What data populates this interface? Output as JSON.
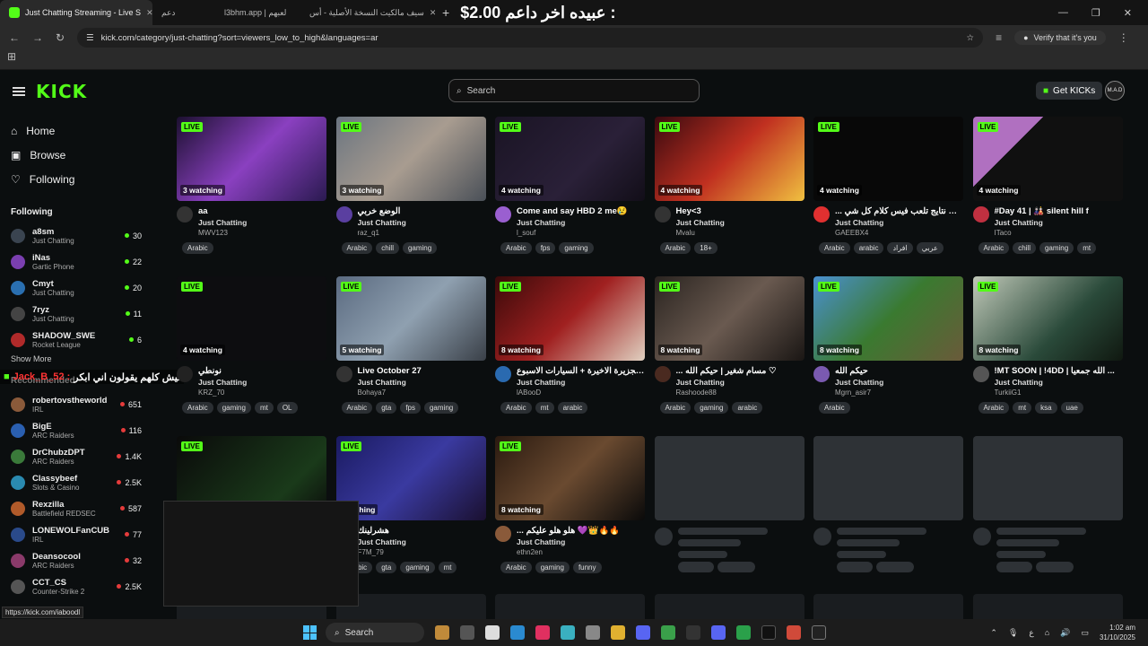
{
  "browser": {
    "tabs": [
      {
        "label": "Just Chatting Streaming - Live S",
        "active": true
      },
      {
        "label": "دعم",
        "active": false
      },
      {
        "label": "l3bhm.app | لعبهم",
        "active": false
      },
      {
        "label": "سيف مالكيت النسخة الأصلية - أس",
        "active": false
      }
    ],
    "new_tab": "+",
    "url": "kick.com/category/just-chatting?sort=viewers_low_to_high&languages=ar",
    "verify_label": "Verify that it's you",
    "status_url": "https://kick.com/iaboodl"
  },
  "donation": {
    "text": "عبيده اخر داعم :",
    "amount": "$2.00"
  },
  "header": {
    "logo": "KICK",
    "search_placeholder": "Search",
    "get_kicks": "Get KICKs",
    "avatar": "M.A.D"
  },
  "sidebar": {
    "nav": [
      {
        "label": "Home",
        "icon": "home-icon"
      },
      {
        "label": "Browse",
        "icon": "browse-icon"
      },
      {
        "label": "Following",
        "icon": "heart-icon"
      }
    ],
    "following_title": "Following",
    "following": [
      {
        "name": "a8sm",
        "game": "Just Chatting",
        "viewers": "30",
        "color": "#3a4450"
      },
      {
        "name": "iNas",
        "game": "Gartic Phone",
        "viewers": "22",
        "color": "#7a3fb0"
      },
      {
        "name": "Cmyt",
        "game": "Just Chatting",
        "viewers": "20",
        "color": "#2a6fb0"
      },
      {
        "name": "7ryz",
        "game": "Just Chatting",
        "viewers": "11",
        "color": "#444"
      },
      {
        "name": "SHADOW_SWE",
        "game": "Rocket League",
        "viewers": "6",
        "color": "#b02a2a"
      }
    ],
    "show_more": "Show More",
    "recommended_title": "Recommended",
    "recommended": [
      {
        "name": "robertovstheworld",
        "game": "IRL",
        "viewers": "651",
        "color": "#8a5a3a"
      },
      {
        "name": "BigE",
        "game": "ARC Raiders",
        "viewers": "116",
        "color": "#2a5fb0"
      },
      {
        "name": "DrChubzDPT",
        "game": "ARC Raiders",
        "viewers": "1.4K",
        "color": "#3a7a3a"
      },
      {
        "name": "Classybeef",
        "game": "Slots & Casino",
        "viewers": "2.5K",
        "color": "#2a8ab0"
      },
      {
        "name": "Rexzilla",
        "game": "Battlefield REDSEC",
        "viewers": "587",
        "color": "#b05a2a"
      },
      {
        "name": "LONEWOLFanCUB",
        "game": "IRL",
        "viewers": "77",
        "color": "#2a4a8a"
      },
      {
        "name": "Deansocool",
        "game": "ARC Raiders",
        "viewers": "32",
        "color": "#8a3a6a"
      },
      {
        "name": "CCT_CS",
        "game": "Counter-Strike 2",
        "viewers": "2.5K",
        "color": "#555"
      }
    ]
  },
  "chat_overlay": {
    "user": "Jack_B_52 :",
    "message": "ليش كلهم يقولون اني ابكر"
  },
  "streams": [
    {
      "title": "aa",
      "category": "Just Chatting",
      "user": "MWV123",
      "watching": "3 watching",
      "tags": [
        "Arabic"
      ],
      "bg": "linear-gradient(135deg,#1c1030,#8a40c0 50%,#2a1a50)",
      "av": "#333"
    },
    {
      "title": "الوضع خربي",
      "category": "Just Chatting",
      "user": "raz_q1",
      "watching": "3 watching",
      "tags": [
        "Arabic",
        "chill",
        "gaming"
      ],
      "bg": "linear-gradient(135deg,#6b7580,#a89c90 50%,#4a5058)",
      "av": "#5a3fa0"
    },
    {
      "title": "Come and say HBD 2 me😢",
      "category": "Just Chatting",
      "user": "l_souf",
      "watching": "4 watching",
      "tags": [
        "Arabic",
        "fps",
        "gaming"
      ],
      "bg": "linear-gradient(135deg,#1a1424,#2a2038 60%,#120e18)",
      "av": "#9a5fd0"
    },
    {
      "title": "Hey<3",
      "category": "Just Chatting",
      "user": "Mvalu",
      "watching": "4 watching",
      "tags": [
        "Arabic",
        "18+"
      ],
      "bg": "linear-gradient(135deg,#3a0a10,#c03020 50%,#f0c040)",
      "av": "#333"
    },
    {
      "title": "... هشروالي نتايج تلعب فيس كلام كل شي",
      "category": "Just Chatting",
      "user": "GAEEBX4",
      "watching": "4 watching",
      "tags": [
        "Arabic",
        "arabic",
        "افراد",
        "عربي"
      ],
      "bg": "#080808",
      "av": "#e03030"
    },
    {
      "title": "#Day 41 | 🎎 silent hill f",
      "category": "Just Chatting",
      "user": "ITaco",
      "watching": "4 watching",
      "tags": [
        "Arabic",
        "chill",
        "gaming",
        "mt"
      ],
      "bg": "linear-gradient(135deg,#b070c0 0 30%,#101010 30%)",
      "av": "#c03040"
    },
    {
      "title": "نونطي",
      "category": "Just Chatting",
      "user": "KRZ_70",
      "watching": "4 watching",
      "tags": [
        "Arabic",
        "gaming",
        "mt",
        "OL"
      ],
      "bg": "#0d0d10",
      "av": "#222"
    },
    {
      "title": "Live October 27",
      "category": "Just Chatting",
      "user": "Bohaya7",
      "watching": "5 watching",
      "tags": [
        "Arabic",
        "gta",
        "fps",
        "gaming"
      ],
      "bg": "linear-gradient(135deg,#5a6a80,#8fa0b0 50%,#3a4048)",
      "av": "#333"
    },
    {
      "title": "حلقة الجزيرة الاخيرة + السيارات الاسبوع",
      "category": "Just Chatting",
      "user": "lABooD",
      "watching": "8 watching",
      "tags": [
        "Arabic",
        "mt",
        "arabic"
      ],
      "bg": "linear-gradient(135deg,#3a0a0a,#a02020 50%,#e0d0c0)",
      "av": "#2a6ab0"
    },
    {
      "title": "... مسام شغير | حيكم الله ♡",
      "category": "Just Chatting",
      "user": "Rashoode88",
      "watching": "8 watching",
      "tags": [
        "Arabic",
        "gaming",
        "arabic"
      ],
      "bg": "linear-gradient(135deg,#2a2420,#6a5a50 50%,#1a1614)",
      "av": "#4a2a20"
    },
    {
      "title": "حيكم الله",
      "category": "Just Chatting",
      "user": "Mgrn_asir7",
      "watching": "8 watching",
      "tags": [
        "Arabic"
      ],
      "bg": "linear-gradient(135deg,#4a90d0,#3a7a30 50%,#6a5a3a)",
      "av": "#7a5ab0"
    },
    {
      "title": "!MT SOON | !4DD | الله جمعيا ...",
      "category": "Just Chatting",
      "user": "TurkiiG1",
      "watching": "8 watching",
      "tags": [
        "Arabic",
        "mt",
        "ksa",
        "uae"
      ],
      "bg": "linear-gradient(135deg,#c0c8b8,#2a4a3a 60%,#101810)",
      "av": "#555"
    },
    {
      "title": "",
      "category": "",
      "user": "",
      "watching": "",
      "tags": [],
      "bg": "linear-gradient(135deg,#0a0a0a,#1a3a1a 70%,#0a0a0a)",
      "av": "#111"
    },
    {
      "title": "هشرلينك",
      "category": "Just Chatting",
      "user": "F7M_79",
      "watching": "watching",
      "tags": [
        "Arabic",
        "gta",
        "gaming",
        "mt"
      ],
      "bg": "linear-gradient(135deg,#1a1a60,#3a3aa0 50%,#1a1030)",
      "av": "#222"
    },
    {
      "title": "... هلو هلو عليكم 💜👑🔥🔥",
      "category": "Just Chatting",
      "user": "ethn2en",
      "watching": "8 watching",
      "tags": [
        "Arabic",
        "gaming",
        "funny"
      ],
      "bg": "linear-gradient(135deg,#2a1a10,#6a4a30 50%,#0a0a0a)",
      "av": "#8a5a3a"
    }
  ],
  "taskbar": {
    "search": "Search",
    "time": "1:02 am",
    "date": "31/10/2025",
    "lang": "ع"
  }
}
